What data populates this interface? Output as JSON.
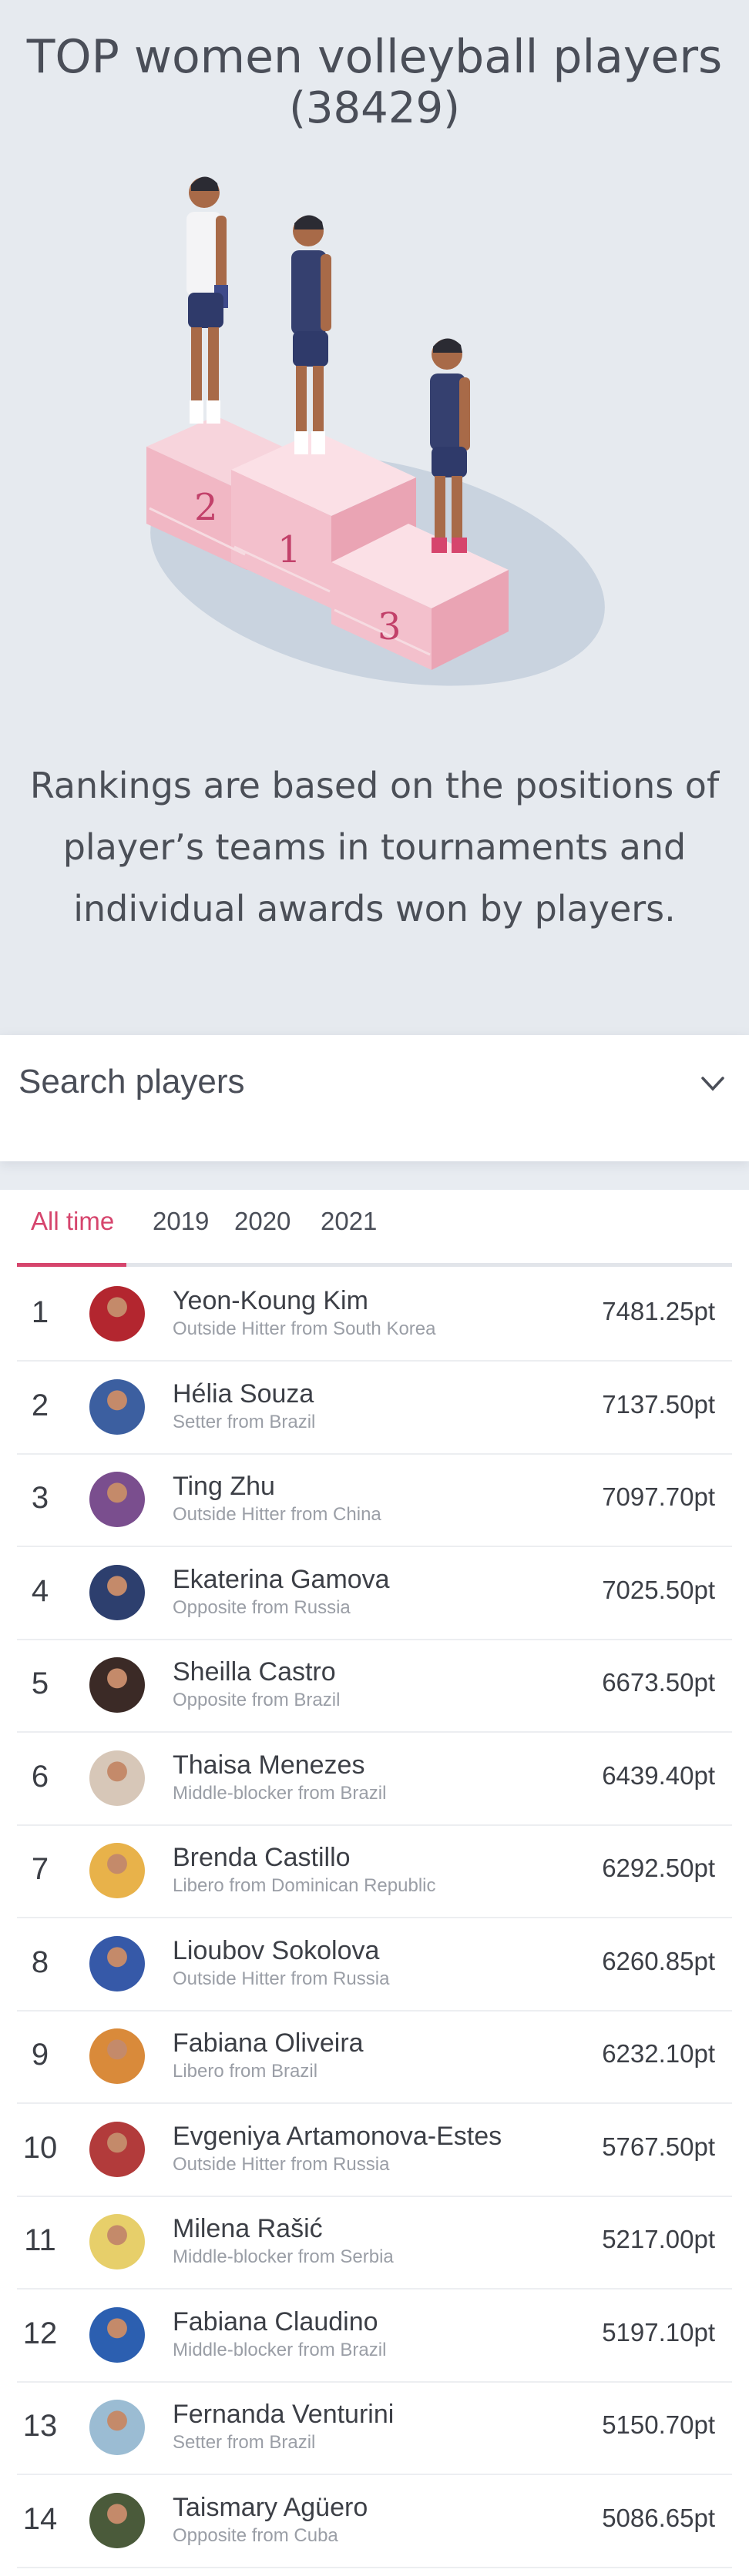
{
  "header": {
    "title": "TOP women volleyball players",
    "count": "(38429)",
    "description": "Rankings are based on the positions of player’s teams in tournaments and individual awards won by players."
  },
  "podium": {
    "labels": [
      "2",
      "1",
      "3"
    ]
  },
  "search": {
    "label": "Search players"
  },
  "tabs": [
    "All time",
    "2019",
    "2020",
    "2021"
  ],
  "colors": {
    "accent": "#d6456d",
    "background": "#e6eaef"
  },
  "players": [
    {
      "rank": "1",
      "name": "Yeon-Koung Kim",
      "sub": "Outside Hitter from South Korea",
      "points": "7481.25pt"
    },
    {
      "rank": "2",
      "name": "Hélia Souza",
      "sub": "Setter from Brazil",
      "points": "7137.50pt"
    },
    {
      "rank": "3",
      "name": "Ting Zhu",
      "sub": "Outside Hitter from China",
      "points": "7097.70pt"
    },
    {
      "rank": "4",
      "name": "Ekaterina Gamova",
      "sub": "Opposite from Russia",
      "points": "7025.50pt"
    },
    {
      "rank": "5",
      "name": "Sheilla Castro",
      "sub": "Opposite from Brazil",
      "points": "6673.50pt"
    },
    {
      "rank": "6",
      "name": "Thaisa Menezes",
      "sub": "Middle-blocker from Brazil",
      "points": "6439.40pt"
    },
    {
      "rank": "7",
      "name": "Brenda Castillo",
      "sub": "Libero from Dominican Republic",
      "points": "6292.50pt"
    },
    {
      "rank": "8",
      "name": "Lioubov Sokolova",
      "sub": "Outside Hitter from Russia",
      "points": "6260.85pt"
    },
    {
      "rank": "9",
      "name": "Fabiana Oliveira",
      "sub": "Libero from Brazil",
      "points": "6232.10pt"
    },
    {
      "rank": "10",
      "name": "Evgeniya Artamonova-Estes",
      "sub": "Outside Hitter from Russia",
      "points": "5767.50pt"
    },
    {
      "rank": "11",
      "name": "Milena Rašić",
      "sub": "Middle-blocker from Serbia",
      "points": "5217.00pt"
    },
    {
      "rank": "12",
      "name": "Fabiana Claudino",
      "sub": "Middle-blocker from Brazil",
      "points": "5197.10pt"
    },
    {
      "rank": "13",
      "name": "Fernanda Venturini",
      "sub": "Setter from Brazil",
      "points": "5150.70pt"
    },
    {
      "rank": "14",
      "name": "Taismary Agüero",
      "sub": "Opposite from Cuba",
      "points": "5086.65pt"
    }
  ]
}
